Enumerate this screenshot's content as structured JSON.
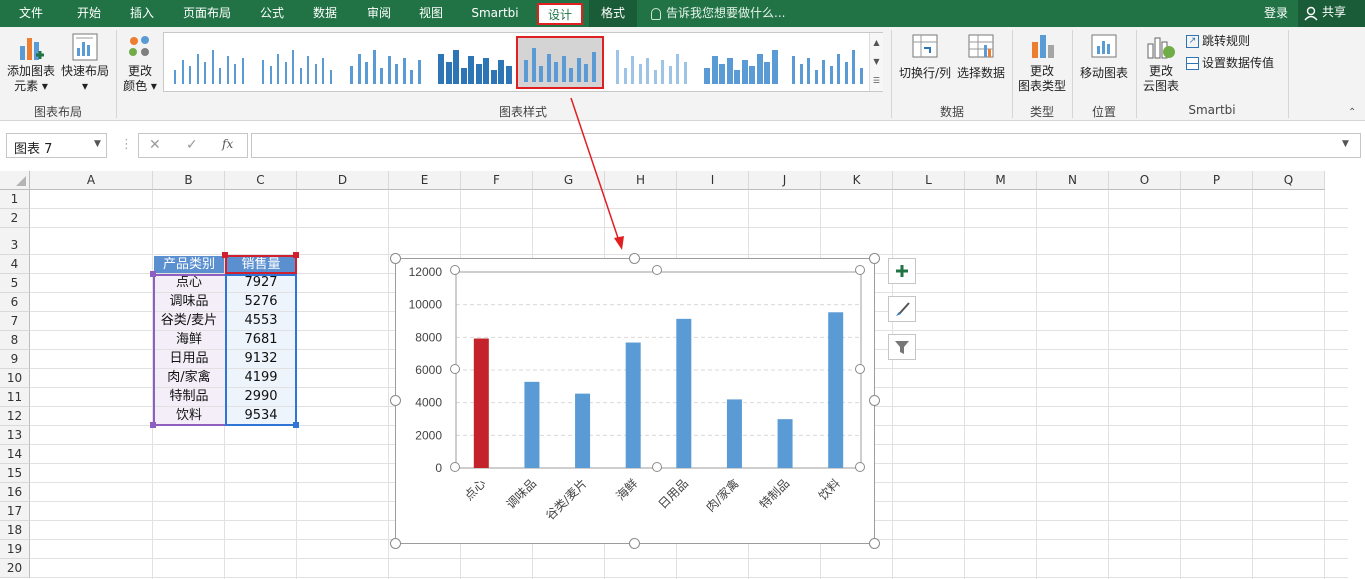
{
  "menu": {
    "tabs": [
      "文件",
      "开始",
      "插入",
      "页面布局",
      "公式",
      "数据",
      "审阅",
      "视图",
      "Smartbi",
      "设计",
      "格式"
    ],
    "tell_me": "告诉我您想要做什么...",
    "login": "登录",
    "share": "共享"
  },
  "ribbon": {
    "add_element": [
      "添加图表",
      "元素"
    ],
    "quick_layout": "快速布局",
    "change_color": [
      "更改",
      "颜色"
    ],
    "group_layout": "图表布局",
    "group_styles": "图表样式",
    "switch_row_col": "切换行/列",
    "select_data": "选择数据",
    "group_data": "数据",
    "change_type": [
      "更改",
      "图表类型"
    ],
    "group_type": "类型",
    "move_chart": "移动图表",
    "group_location": "位置",
    "change_cloud": [
      "更改",
      "云图表"
    ],
    "jump_rule": "跳转规则",
    "set_pass_value": "设置数据传值",
    "group_smartbi": "Smartbi"
  },
  "formula_bar": {
    "name_box": "图表 7",
    "cancel": "✕",
    "enter": "✓",
    "fx": "fx",
    "formula": ""
  },
  "sheet": {
    "columns": [
      "A",
      "B",
      "C",
      "D",
      "E",
      "F",
      "G",
      "H",
      "I",
      "J",
      "K",
      "L",
      "M",
      "N",
      "O",
      "P",
      "Q"
    ],
    "rows": [
      "1",
      "2",
      "3",
      "4",
      "5",
      "6",
      "7",
      "8",
      "9",
      "10",
      "11",
      "12",
      "13",
      "14",
      "15",
      "16",
      "17",
      "18",
      "19",
      "20"
    ],
    "table_header": [
      "产品类别",
      "销售量"
    ],
    "table_rows": [
      [
        "点心",
        "7927"
      ],
      [
        "调味品",
        "5276"
      ],
      [
        "谷类/麦片",
        "4553"
      ],
      [
        "海鲜",
        "7681"
      ],
      [
        "日用品",
        "9132"
      ],
      [
        "肉/家禽",
        "4199"
      ],
      [
        "特制品",
        "2990"
      ],
      [
        "饮料",
        "9534"
      ]
    ]
  },
  "chart_data": {
    "type": "bar",
    "categories": [
      "点心",
      "调味品",
      "谷类/麦片",
      "海鲜",
      "日用品",
      "肉/家禽",
      "特制品",
      "饮料"
    ],
    "values": [
      7927,
      5276,
      4553,
      7681,
      9132,
      4199,
      2990,
      9534
    ],
    "ylim": [
      0,
      12000
    ],
    "yticks": [
      "0",
      "2000",
      "4000",
      "6000",
      "8000",
      "10000",
      "12000"
    ],
    "title": "",
    "xlabel": "",
    "ylabel": "",
    "grid": true,
    "colors": {
      "default": "#5b9bd5",
      "highlight": "#c5232b"
    },
    "highlight_index": 0
  },
  "colors": {
    "menu_bg": "#217346",
    "header_fill": "#5a8fd0",
    "annotation": "#e02020"
  }
}
